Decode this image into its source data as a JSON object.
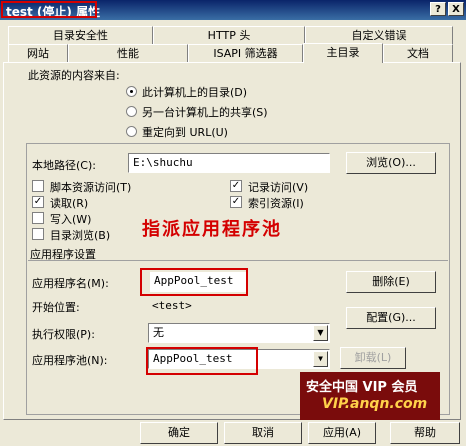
{
  "window": {
    "title_prefix": "test (停止)",
    "title_suffix": " 属性",
    "help_glyph": "?",
    "close_glyph": "X"
  },
  "tabs_back": [
    "目录安全性",
    "HTTP 头",
    "自定义错误"
  ],
  "tabs_front": [
    "网站",
    "性能",
    "ISAPI 筛选器",
    "主目录",
    "文档"
  ],
  "active_tab": "主目录",
  "source": {
    "heading": "此资源的内容来自:",
    "options": [
      "此计算机上的目录(D)",
      "另一台计算机上的共享(S)",
      "重定向到 URL(U)"
    ],
    "selected": 0
  },
  "local_path": {
    "label": "本地路径(C):",
    "value": "E:\\shuchu",
    "browse_button": "浏览(O)..."
  },
  "checkboxes": [
    {
      "label": "脚本资源访问(T)",
      "checked": false
    },
    {
      "label": "读取(R)",
      "checked": true
    },
    {
      "label": "写入(W)",
      "checked": false
    },
    {
      "label": "目录浏览(B)",
      "checked": false
    },
    {
      "label": "记录访问(V)",
      "checked": true
    },
    {
      "label": "索引资源(I)",
      "checked": true
    }
  ],
  "annotation": "指派应用程序池",
  "app_settings": {
    "heading": "应用程序设置",
    "app_name_label": "应用程序名(M):",
    "app_name_value": "AppPool_test",
    "remove_button": "删除(E)",
    "start_label": "开始位置:",
    "start_value": "<test>",
    "config_button": "配置(G)...",
    "exec_label": "执行权限(P):",
    "exec_value": "无",
    "pool_label": "应用程序池(N):",
    "pool_value": "AppPool_test",
    "unload_button": "卸载(L)"
  },
  "footer": {
    "ok": "确定",
    "cancel": "取消",
    "apply": "应用(A)",
    "help": "帮助"
  },
  "watermark": {
    "line1": "安全中国 VIP 会员",
    "line2": "VIP.anqn.com"
  },
  "colors": {
    "titlebar": "#0a246a",
    "annotation_red": "#d40000",
    "watermark_bg": "#7a0c0c"
  }
}
